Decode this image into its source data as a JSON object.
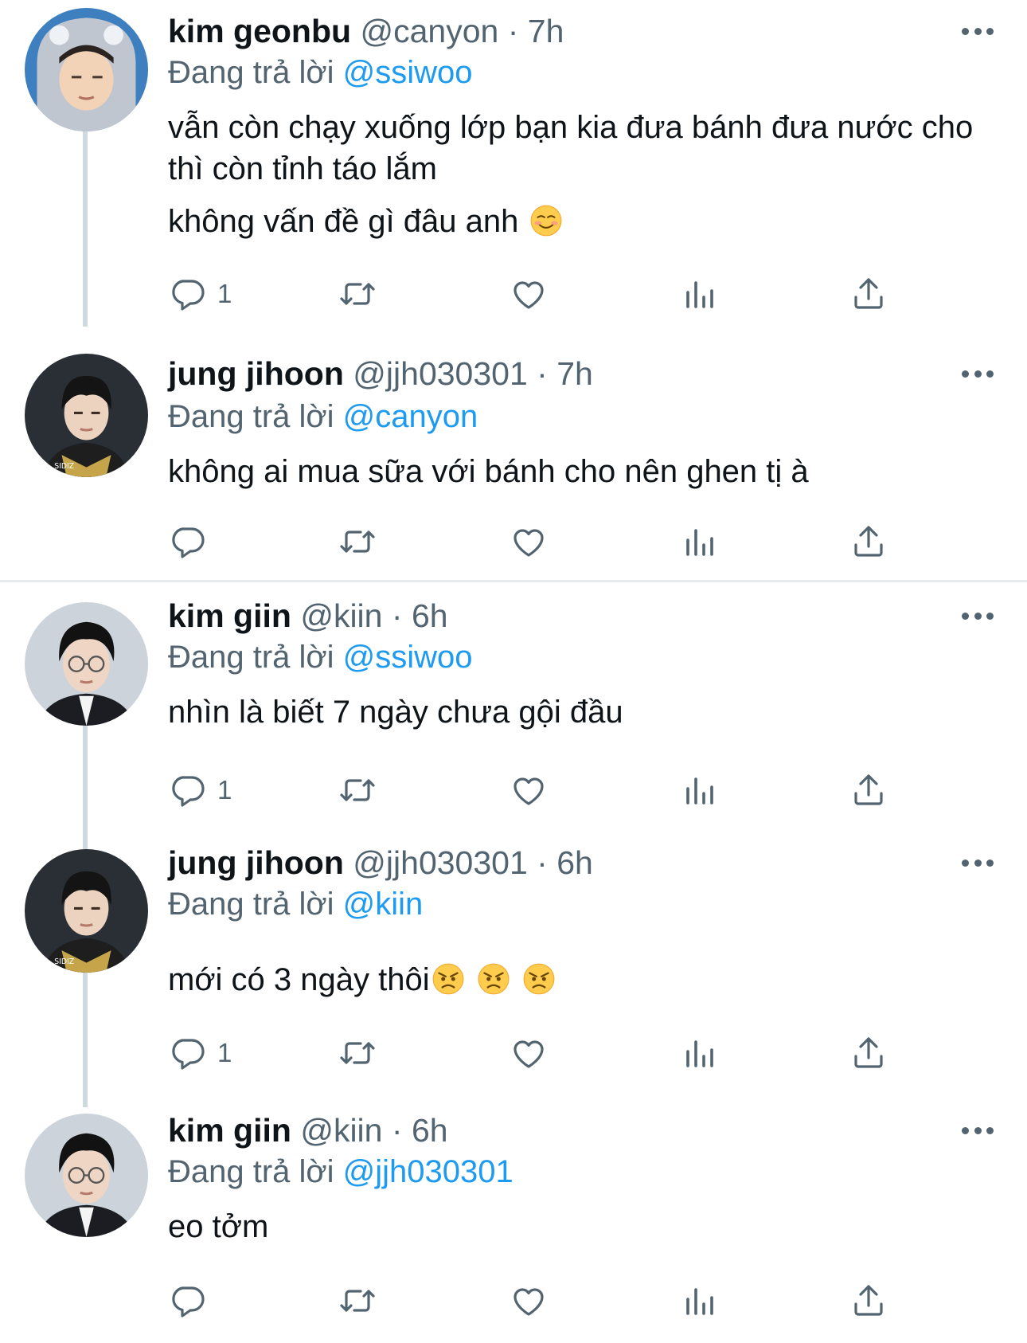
{
  "ui": {
    "replying_prefix": "Đang trả lời"
  },
  "colors": {
    "name": "#0f1419",
    "muted": "#536471",
    "link": "#1d9bf0",
    "thread_line": "#cfd9de",
    "divider": "#e7ebee"
  },
  "icons": [
    "reply-icon",
    "retweet-icon",
    "like-icon",
    "analytics-icon",
    "share-icon",
    "more-icon"
  ],
  "tweets": [
    {
      "name": "kim geonbu",
      "handle": "@canyon",
      "separator": "·",
      "time": "7h",
      "replying_to": "@ssiwoo",
      "paragraphs": [
        "vẫn còn chạy xuống lớp bạn kia đưa bánh đưa nước cho thì còn tỉnh táo lắm",
        "không vấn đề gì đâu anh"
      ],
      "emoji": [
        "smiling-face-emoji"
      ],
      "reply_count": "1"
    },
    {
      "name": "jung jihoon",
      "handle": "@jjh030301",
      "separator": "·",
      "time": "7h",
      "replying_to": "@canyon",
      "paragraphs": [
        "không ai mua sữa với bánh cho nên ghen tị à"
      ],
      "reply_count": ""
    },
    {
      "name": "kim giin",
      "handle": "@kiin",
      "separator": "·",
      "time": "6h",
      "replying_to": "@ssiwoo",
      "paragraphs": [
        "nhìn là biết 7 ngày chưa gội đầu"
      ],
      "reply_count": "1"
    },
    {
      "name": "jung jihoon",
      "handle": "@jjh030301",
      "separator": "·",
      "time": "6h",
      "replying_to": "@kiin",
      "paragraphs": [
        "mới có 3 ngày thôi"
      ],
      "emoji": [
        "angry-face-emoji",
        "angry-face-emoji",
        "angry-face-emoji"
      ],
      "reply_count": "1"
    },
    {
      "name": "kim giin",
      "handle": "@kiin",
      "separator": "·",
      "time": "6h",
      "replying_to": "@jjh030301",
      "paragraphs": [
        "eo tởm"
      ],
      "reply_count": ""
    }
  ]
}
